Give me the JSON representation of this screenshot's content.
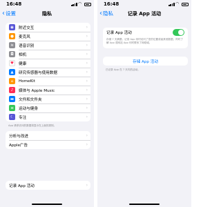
{
  "status": {
    "time": "16:48"
  },
  "left": {
    "back": "设置",
    "title": "隐私",
    "items": [
      {
        "label": "附近交互",
        "icon": "nearby-interaction-icon",
        "color": "#5856d6",
        "glyph": "◉"
      },
      {
        "label": "麦克风",
        "icon": "microphone-icon",
        "color": "#ff9500",
        "glyph": "●"
      },
      {
        "label": "语音识别",
        "icon": "speech-recognition-icon",
        "color": "#8e8e93",
        "glyph": "≋"
      },
      {
        "label": "相机",
        "icon": "camera-icon",
        "color": "#8e8e93",
        "glyph": "◘"
      },
      {
        "label": "健康",
        "icon": "health-icon",
        "color": "#ffffff",
        "glyph": "♥"
      },
      {
        "label": "研究传感器与使用数据",
        "icon": "research-icon",
        "color": "#007aff",
        "glyph": "▲"
      },
      {
        "label": "HomeKit",
        "icon": "homekit-icon",
        "color": "#ff9500",
        "glyph": "⌂"
      },
      {
        "label": "媒体与 Apple Music",
        "icon": "music-icon",
        "color": "#ff2d55",
        "glyph": "♪"
      },
      {
        "label": "文件和文件夹",
        "icon": "folder-icon",
        "color": "#007aff",
        "glyph": "▬"
      },
      {
        "label": "运动与健身",
        "icon": "fitness-icon",
        "color": "#34c759",
        "glyph": "≡"
      },
      {
        "label": "专注",
        "icon": "focus-icon",
        "color": "#5856d6",
        "glyph": "☾"
      }
    ],
    "note": "App 请求访问的数据将显示在上面的类别。",
    "group2": [
      "分析与改进",
      "Apple广告"
    ],
    "group3": [
      "记录 App 活动"
    ]
  },
  "right": {
    "back": "隐私",
    "title": "记录 App 活动",
    "toggle_label": "记录 App 活动",
    "toggle_on": true,
    "desc": "存储 7 天摘要，记录 App 何时访问了您的位置或者其他数据，同时了解 App 或网站 App 何时联系了网络域。",
    "save_button": "存储 App 活动",
    "note": "已记录 App 在 7 天内的活动。"
  }
}
